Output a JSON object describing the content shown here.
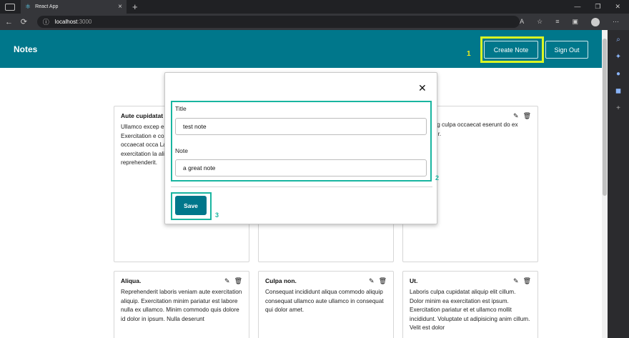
{
  "browser": {
    "tab_title": "React App",
    "tab_icon": "react-atom-icon",
    "url_host": "localhost",
    "url_port": ":3000"
  },
  "header": {
    "title": "Notes",
    "create_label": "Create Note",
    "signout_label": "Sign Out",
    "accent": "#00778b"
  },
  "annotations": {
    "n1": "1",
    "n2": "2",
    "n3": "3",
    "yellow": "#d9f523",
    "teal": "#19b5a0"
  },
  "modal": {
    "close_glyph": "✕",
    "title_label": "Title",
    "title_value": "test note",
    "note_label": "Note",
    "note_value": "a great note",
    "save_label": "Save"
  },
  "cards": [
    {
      "title": "Aute cupidatat",
      "body": "Ullamco excep eiusmod labor laborum ut do Exercitation e consectetur d Eu eu repreh occaecat occa Labore qui no deserunt. Qui exercitation la aliqua cupidatat magna reprehenderit."
    },
    {
      "title": "",
      "body": "t adipisicing culpa occaecat eserunt do ex consectetur."
    },
    {
      "title": "Aliqua.",
      "body": "Reprehenderit laboris veniam aute exercitation aliquip. Exercitation minim pariatur est labore nulla ex ullamco. Minim commodo quis dolore id dolor in ipsum. Nulla deserunt"
    },
    {
      "title": "Culpa non.",
      "body": "Consequat incididunt aliqua commodo aliquip consequat ullamco aute ullamco in consequat qui dolor amet."
    },
    {
      "title": "Ut.",
      "body": "Laboris culpa cupidatat aliquip elit cillum. Dolor minim ea exercitation est ipsum. Exercitation pariatur et et ullamco mollit incididunt. Voluptate ut adipisicing anim cillum. Velit est dolor"
    }
  ]
}
